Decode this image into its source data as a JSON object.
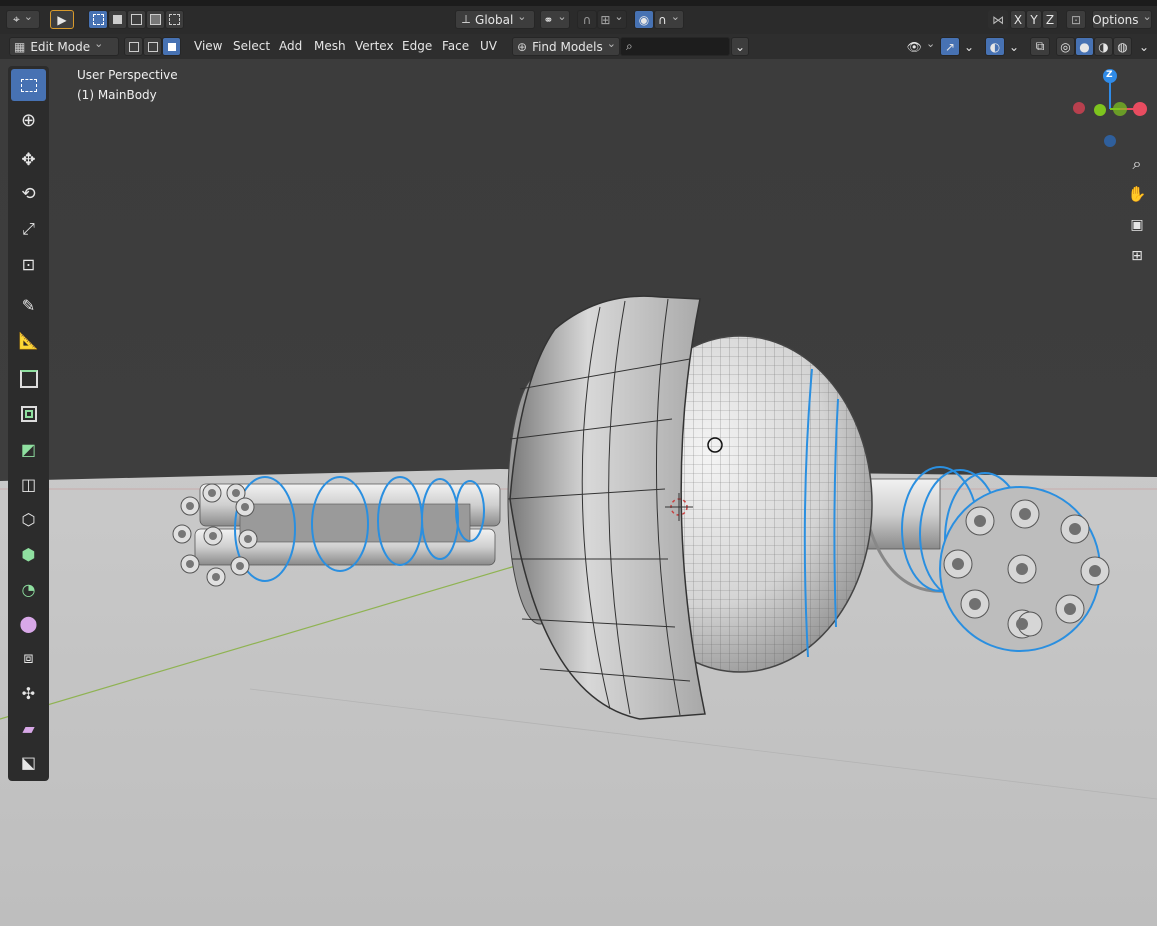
{
  "header1": {
    "transform_orientation": "Global",
    "axis_x": "X",
    "axis_y": "Y",
    "axis_z": "Z",
    "options_label": "Options"
  },
  "header2": {
    "mode": "Edit Mode",
    "menus": [
      "View",
      "Select",
      "Add",
      "Mesh",
      "Vertex",
      "Edge",
      "Face",
      "UV"
    ],
    "find_models_label": "Find Models",
    "search_placeholder": ""
  },
  "viewport": {
    "view_name": "User Perspective",
    "object_label": "(1) MainBody"
  },
  "gizmo": {
    "z_label": "Z"
  },
  "colors": {
    "accent": "#4772b3",
    "selected_edge": "#2a8fe0",
    "axis_x": "#e84c60",
    "axis_y": "#7ec41e",
    "axis_z": "#2f8be8",
    "floor": "#c8c8c8",
    "sky": "#3a3a3a"
  },
  "toolbar_tools": [
    "select-box",
    "cursor",
    "move",
    "rotate",
    "scale",
    "transform",
    "annotate",
    "measure",
    "extrude-region",
    "inset-faces",
    "bevel",
    "loop-cut",
    "knife",
    "poly-build",
    "spin",
    "smooth",
    "edge-slide",
    "shrink-fatten",
    "shear",
    "rip-region"
  ]
}
